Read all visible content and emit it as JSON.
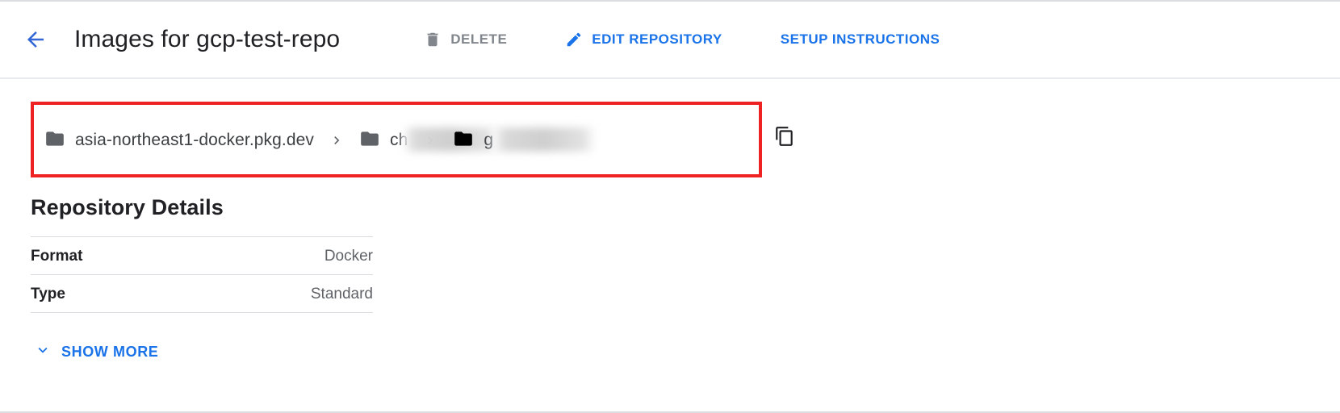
{
  "header": {
    "back_icon": "arrow-back-icon",
    "title": "Images for gcp-test-repo",
    "actions": [
      {
        "id": "delete",
        "label": "DELETE",
        "icon": "trash-icon",
        "state": "disabled",
        "color": "#80868b"
      },
      {
        "id": "edit-repository",
        "label": "EDIT REPOSITORY",
        "icon": "pencil-icon",
        "state": "enabled",
        "color": "#1a73e8"
      },
      {
        "id": "setup-instructions",
        "label": "SETUP INSTRUCTIONS",
        "icon": "none",
        "state": "enabled",
        "color": "#1a73e8"
      }
    ]
  },
  "breadcrumb": {
    "highlight_color": "#ee2222",
    "separator": "chevron-right-icon",
    "items": [
      {
        "label": "asia-northeast1-docker.pkg.dev",
        "icon": "folder-icon",
        "icon_color": "#5f6368",
        "redacted": false
      },
      {
        "label": "ch",
        "icon": "folder-icon",
        "icon_color": "#5f6368",
        "redacted": true
      },
      {
        "label": "g",
        "icon": "folder-icon",
        "icon_color": "#000000",
        "redacted": true
      }
    ],
    "copy_icon": "copy-icon"
  },
  "details": {
    "title": "Repository Details",
    "rows": [
      {
        "key": "Format",
        "value": "Docker"
      },
      {
        "key": "Type",
        "value": "Standard"
      }
    ],
    "show_more": {
      "label": "SHOW MORE",
      "icon": "chevron-down-icon"
    }
  },
  "theme": {
    "accent": "#1a73e8",
    "text_primary": "#202124",
    "text_secondary": "#5f6368",
    "divider": "#dadce0",
    "highlight": "#ee2222"
  }
}
